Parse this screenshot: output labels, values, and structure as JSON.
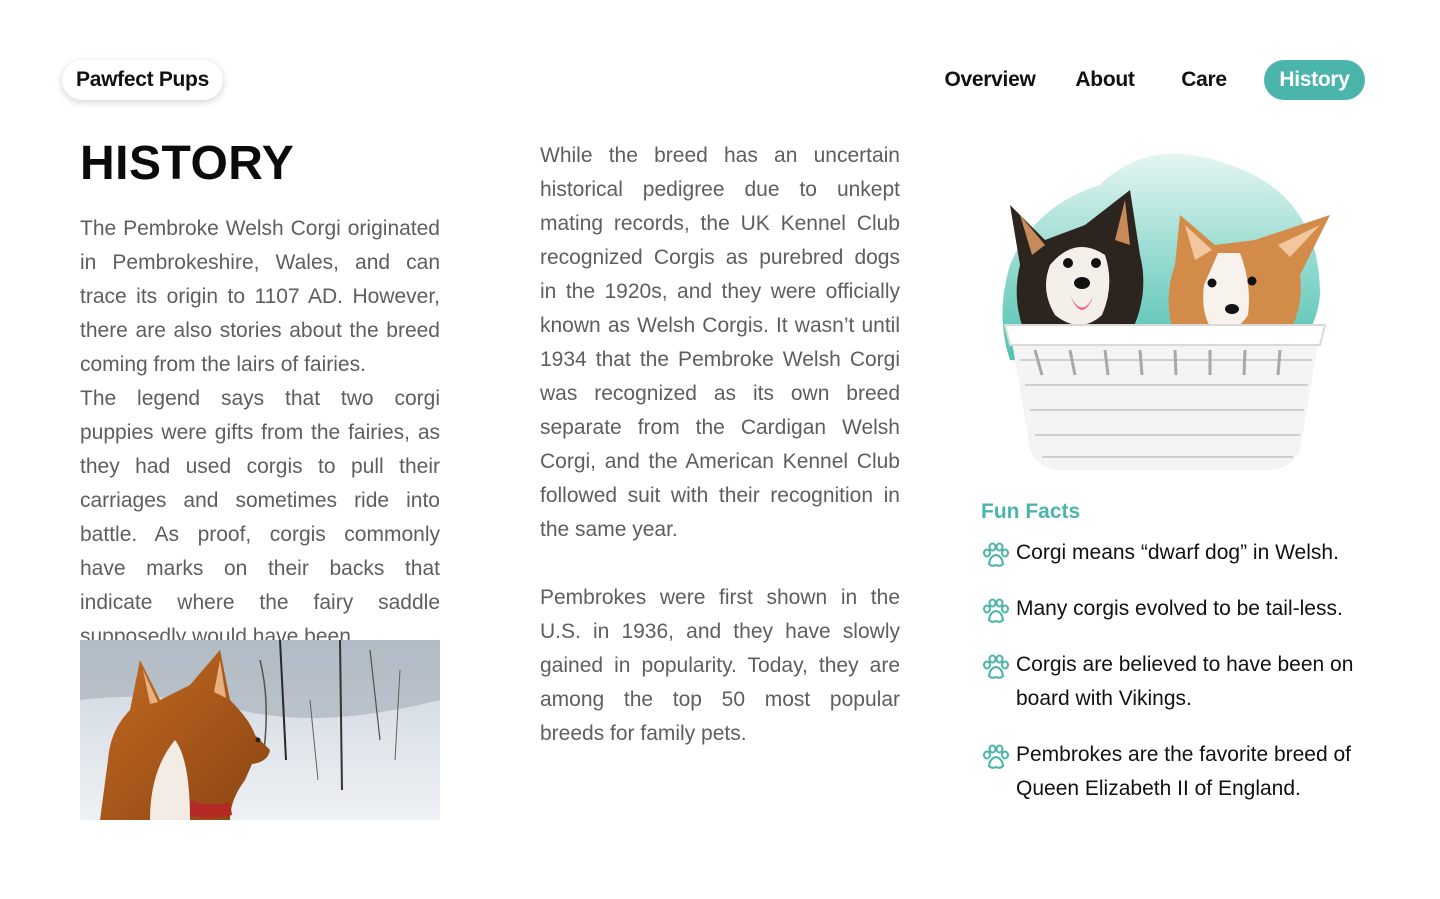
{
  "brand": {
    "name": "Pawfect Pups"
  },
  "nav": {
    "items": [
      {
        "label": "Overview"
      },
      {
        "label": "About"
      },
      {
        "label": "Care"
      },
      {
        "label": "History"
      }
    ],
    "active": "History"
  },
  "page": {
    "title": "HISTORY",
    "paragraphs": [
      "The Pembroke Welsh Corgi originated in Pembrokeshire, Wales, and can trace its origin to 1107 AD. However, there are also stories about the breed coming from the lairs of fairies.",
      "The legend says that two corgi puppies were gifts from the fairies, as they had used corgis to pull their carriages and sometimes ride into battle. As proof, corgis commonly have marks on their backs that indicate where the fairy saddle supposedly would have been.",
      "While the breed has an uncertain historical pedigree due to unkept mating records, the UK Kennel Club recognized Corgis as purebred dogs in the 1920s, and they were officially known as Welsh Corgis. It wasn’t until 1934 that the Pembroke Welsh Corgi was recognized as its own breed separate from the Cardigan Welsh Corgi, and the American Kennel Club followed suit with their recognition in the same year.",
      "Pembrokes were first shown in the U.S. in 1936, and they have slowly gained in popularity. Today, they are among the top 50 most popular breeds for family pets."
    ]
  },
  "fun_facts": {
    "title": "Fun Facts",
    "icon": "paw-icon",
    "items": [
      "Corgi means “dwarf dog” in Welsh.",
      "Many corgis evolved to be tail-less.",
      "Corgis are believed to have been on board with Vikings.",
      "Pembrokes are the favorite breed of Queen Elizabeth II of England."
    ]
  },
  "colors": {
    "accent": "#4cb5ab",
    "text_dark": "#111111",
    "text_body": "#5e5e5e"
  },
  "images": {
    "puppies": "two-corgi-puppies-in-basket",
    "winter": "corgi-in-snow"
  }
}
